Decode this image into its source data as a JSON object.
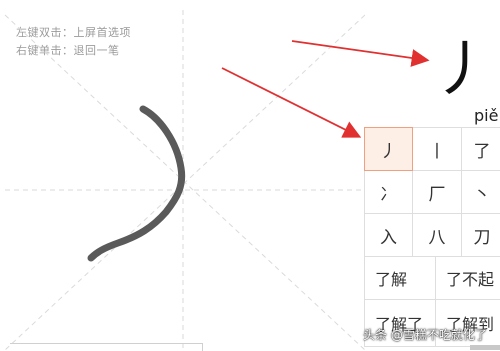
{
  "hints": {
    "line1": "左键双击：上屏首选项",
    "line2": "右键单击：退回一笔"
  },
  "preview": {
    "character": "丿",
    "pinyin": "piě"
  },
  "candidates": {
    "row1": [
      "丿",
      "丨",
      "了"
    ],
    "row2": [
      "冫",
      "厂",
      "丶"
    ],
    "row3": [
      "入",
      "八",
      "刀"
    ]
  },
  "phrases": {
    "row1": [
      "了解",
      "了不起"
    ],
    "row2": [
      "了解了",
      "了解到"
    ]
  },
  "watermark": "头条 @雪糕不吃就化了",
  "colors": {
    "stroke": "#555555",
    "arrow": "#e03030",
    "selected_bg": "#fdeee6"
  }
}
